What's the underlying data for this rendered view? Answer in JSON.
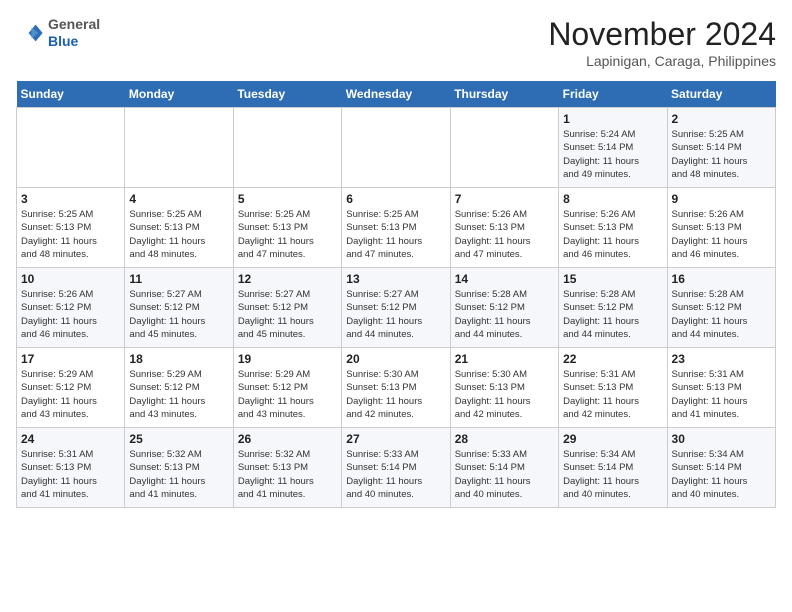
{
  "header": {
    "logo_line1": "General",
    "logo_line2": "Blue",
    "month_year": "November 2024",
    "location": "Lapinigan, Caraga, Philippines"
  },
  "weekdays": [
    "Sunday",
    "Monday",
    "Tuesday",
    "Wednesday",
    "Thursday",
    "Friday",
    "Saturday"
  ],
  "weeks": [
    [
      {
        "num": "",
        "info": ""
      },
      {
        "num": "",
        "info": ""
      },
      {
        "num": "",
        "info": ""
      },
      {
        "num": "",
        "info": ""
      },
      {
        "num": "",
        "info": ""
      },
      {
        "num": "1",
        "info": "Sunrise: 5:24 AM\nSunset: 5:14 PM\nDaylight: 11 hours\nand 49 minutes."
      },
      {
        "num": "2",
        "info": "Sunrise: 5:25 AM\nSunset: 5:14 PM\nDaylight: 11 hours\nand 48 minutes."
      }
    ],
    [
      {
        "num": "3",
        "info": "Sunrise: 5:25 AM\nSunset: 5:13 PM\nDaylight: 11 hours\nand 48 minutes."
      },
      {
        "num": "4",
        "info": "Sunrise: 5:25 AM\nSunset: 5:13 PM\nDaylight: 11 hours\nand 48 minutes."
      },
      {
        "num": "5",
        "info": "Sunrise: 5:25 AM\nSunset: 5:13 PM\nDaylight: 11 hours\nand 47 minutes."
      },
      {
        "num": "6",
        "info": "Sunrise: 5:25 AM\nSunset: 5:13 PM\nDaylight: 11 hours\nand 47 minutes."
      },
      {
        "num": "7",
        "info": "Sunrise: 5:26 AM\nSunset: 5:13 PM\nDaylight: 11 hours\nand 47 minutes."
      },
      {
        "num": "8",
        "info": "Sunrise: 5:26 AM\nSunset: 5:13 PM\nDaylight: 11 hours\nand 46 minutes."
      },
      {
        "num": "9",
        "info": "Sunrise: 5:26 AM\nSunset: 5:13 PM\nDaylight: 11 hours\nand 46 minutes."
      }
    ],
    [
      {
        "num": "10",
        "info": "Sunrise: 5:26 AM\nSunset: 5:12 PM\nDaylight: 11 hours\nand 46 minutes."
      },
      {
        "num": "11",
        "info": "Sunrise: 5:27 AM\nSunset: 5:12 PM\nDaylight: 11 hours\nand 45 minutes."
      },
      {
        "num": "12",
        "info": "Sunrise: 5:27 AM\nSunset: 5:12 PM\nDaylight: 11 hours\nand 45 minutes."
      },
      {
        "num": "13",
        "info": "Sunrise: 5:27 AM\nSunset: 5:12 PM\nDaylight: 11 hours\nand 44 minutes."
      },
      {
        "num": "14",
        "info": "Sunrise: 5:28 AM\nSunset: 5:12 PM\nDaylight: 11 hours\nand 44 minutes."
      },
      {
        "num": "15",
        "info": "Sunrise: 5:28 AM\nSunset: 5:12 PM\nDaylight: 11 hours\nand 44 minutes."
      },
      {
        "num": "16",
        "info": "Sunrise: 5:28 AM\nSunset: 5:12 PM\nDaylight: 11 hours\nand 44 minutes."
      }
    ],
    [
      {
        "num": "17",
        "info": "Sunrise: 5:29 AM\nSunset: 5:12 PM\nDaylight: 11 hours\nand 43 minutes."
      },
      {
        "num": "18",
        "info": "Sunrise: 5:29 AM\nSunset: 5:12 PM\nDaylight: 11 hours\nand 43 minutes."
      },
      {
        "num": "19",
        "info": "Sunrise: 5:29 AM\nSunset: 5:12 PM\nDaylight: 11 hours\nand 43 minutes."
      },
      {
        "num": "20",
        "info": "Sunrise: 5:30 AM\nSunset: 5:13 PM\nDaylight: 11 hours\nand 42 minutes."
      },
      {
        "num": "21",
        "info": "Sunrise: 5:30 AM\nSunset: 5:13 PM\nDaylight: 11 hours\nand 42 minutes."
      },
      {
        "num": "22",
        "info": "Sunrise: 5:31 AM\nSunset: 5:13 PM\nDaylight: 11 hours\nand 42 minutes."
      },
      {
        "num": "23",
        "info": "Sunrise: 5:31 AM\nSunset: 5:13 PM\nDaylight: 11 hours\nand 41 minutes."
      }
    ],
    [
      {
        "num": "24",
        "info": "Sunrise: 5:31 AM\nSunset: 5:13 PM\nDaylight: 11 hours\nand 41 minutes."
      },
      {
        "num": "25",
        "info": "Sunrise: 5:32 AM\nSunset: 5:13 PM\nDaylight: 11 hours\nand 41 minutes."
      },
      {
        "num": "26",
        "info": "Sunrise: 5:32 AM\nSunset: 5:13 PM\nDaylight: 11 hours\nand 41 minutes."
      },
      {
        "num": "27",
        "info": "Sunrise: 5:33 AM\nSunset: 5:14 PM\nDaylight: 11 hours\nand 40 minutes."
      },
      {
        "num": "28",
        "info": "Sunrise: 5:33 AM\nSunset: 5:14 PM\nDaylight: 11 hours\nand 40 minutes."
      },
      {
        "num": "29",
        "info": "Sunrise: 5:34 AM\nSunset: 5:14 PM\nDaylight: 11 hours\nand 40 minutes."
      },
      {
        "num": "30",
        "info": "Sunrise: 5:34 AM\nSunset: 5:14 PM\nDaylight: 11 hours\nand 40 minutes."
      }
    ]
  ]
}
